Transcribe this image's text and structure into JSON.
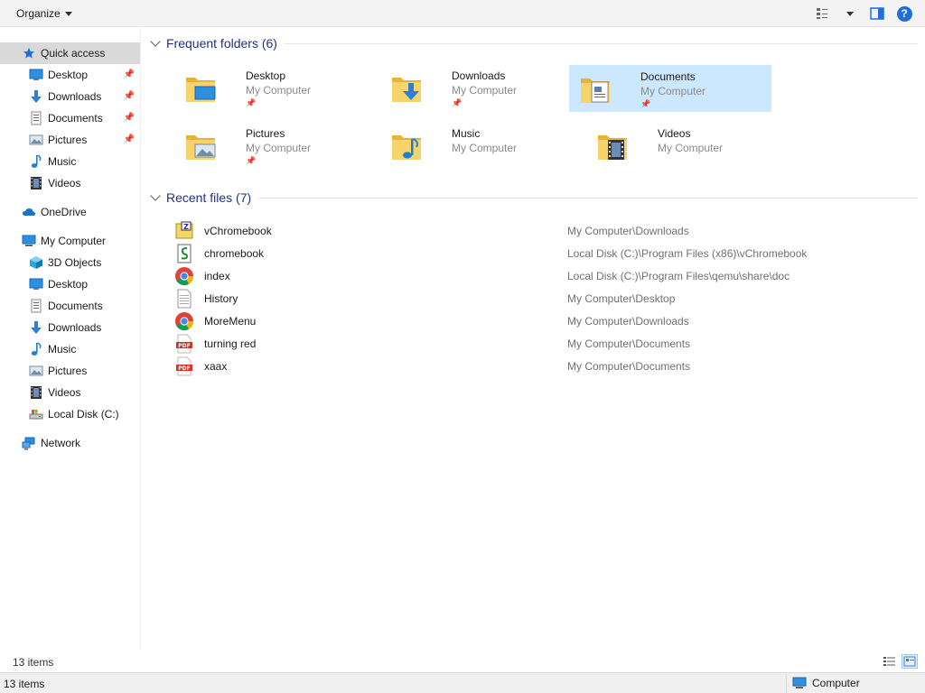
{
  "toolbar": {
    "organize_label": "Organize",
    "icons": [
      "view-options-icon",
      "preview-pane-icon",
      "help-icon"
    ],
    "help_glyph": "?"
  },
  "sidebar": {
    "quick_access": {
      "label": "Quick access",
      "items": [
        {
          "label": "Desktop",
          "icon": "desktop-icon",
          "pinned": true
        },
        {
          "label": "Downloads",
          "icon": "downloads-icon",
          "pinned": true
        },
        {
          "label": "Documents",
          "icon": "documents-icon",
          "pinned": true
        },
        {
          "label": "Pictures",
          "icon": "pictures-icon",
          "pinned": true
        },
        {
          "label": "Music",
          "icon": "music-icon",
          "pinned": false
        },
        {
          "label": "Videos",
          "icon": "videos-icon",
          "pinned": false
        }
      ]
    },
    "onedrive": {
      "label": "OneDrive"
    },
    "my_computer": {
      "label": "My Computer",
      "items": [
        {
          "label": "3D Objects",
          "icon": "3d-objects-icon"
        },
        {
          "label": "Desktop",
          "icon": "desktop-icon"
        },
        {
          "label": "Documents",
          "icon": "documents-icon"
        },
        {
          "label": "Downloads",
          "icon": "downloads-icon"
        },
        {
          "label": "Music",
          "icon": "music-icon"
        },
        {
          "label": "Pictures",
          "icon": "pictures-icon"
        },
        {
          "label": "Videos",
          "icon": "videos-icon"
        },
        {
          "label": "Local Disk (C:)",
          "icon": "local-disk-icon"
        }
      ]
    },
    "network": {
      "label": "Network"
    }
  },
  "frequent": {
    "title": "Frequent folders (6)",
    "folders": [
      {
        "name": "Desktop",
        "location": "My Computer",
        "pinned": true,
        "selected": false,
        "overlay": "desktop"
      },
      {
        "name": "Downloads",
        "location": "My Computer",
        "pinned": true,
        "selected": false,
        "overlay": "downloads"
      },
      {
        "name": "Documents",
        "location": "My Computer",
        "pinned": true,
        "selected": true,
        "overlay": "documents"
      },
      {
        "name": "Pictures",
        "location": "My Computer",
        "pinned": true,
        "selected": false,
        "overlay": "pictures"
      },
      {
        "name": "Music",
        "location": "My Computer",
        "pinned": false,
        "selected": false,
        "overlay": "music"
      },
      {
        "name": "Videos",
        "location": "My Computer",
        "pinned": false,
        "selected": false,
        "overlay": "videos"
      }
    ]
  },
  "recent": {
    "title": "Recent files (7)",
    "files": [
      {
        "name": "vChromebook",
        "path": "My Computer\\Downloads",
        "icon": "zip-archive-icon"
      },
      {
        "name": "chromebook",
        "path": "Local Disk (C:)\\Program Files (x86)\\vChromebook",
        "icon": "script-file-icon"
      },
      {
        "name": "index",
        "path": "Local Disk (C:)\\Program Files\\qemu\\share\\doc",
        "icon": "chrome-icon"
      },
      {
        "name": "History",
        "path": "My Computer\\Desktop",
        "icon": "text-file-icon"
      },
      {
        "name": "MoreMenu",
        "path": "My Computer\\Downloads",
        "icon": "chrome-icon"
      },
      {
        "name": "turning red",
        "path": "My Computer\\Documents",
        "icon": "pdf-icon"
      },
      {
        "name": "xaax",
        "path": "My Computer\\Documents",
        "icon": "pdf-icon"
      }
    ]
  },
  "status": {
    "items_count": "13 items",
    "bottom_items_count": "13 items",
    "location_label": "Computer"
  },
  "colors": {
    "section_title": "#1e3287",
    "selection": "#cce8ff",
    "folder_yellow": "#f4c64f",
    "accent_blue": "#1e6fd9"
  }
}
